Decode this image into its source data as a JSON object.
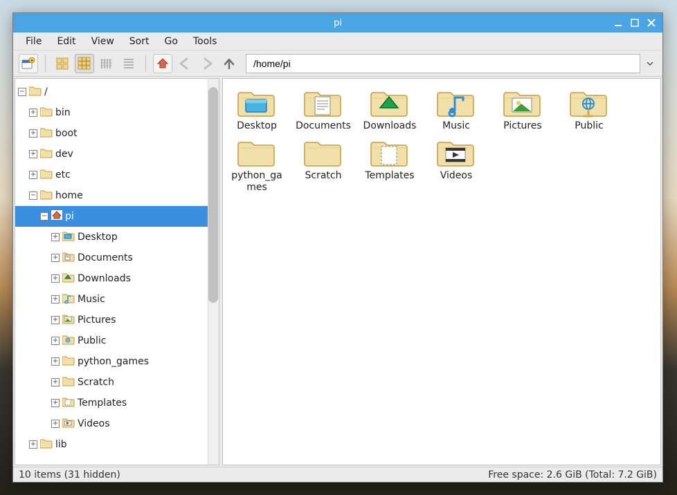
{
  "title": "pi",
  "menu": [
    "File",
    "Edit",
    "View",
    "Sort",
    "Go",
    "Tools"
  ],
  "path": "/home/pi",
  "tree": {
    "root": "/",
    "root_children": [
      {
        "name": "bin",
        "icon": "folder"
      },
      {
        "name": "boot",
        "icon": "folder"
      },
      {
        "name": "dev",
        "icon": "folder"
      },
      {
        "name": "etc",
        "icon": "folder"
      },
      {
        "name": "home",
        "icon": "folder",
        "expanded": true,
        "children": [
          {
            "name": "pi",
            "icon": "home",
            "expanded": true,
            "selected": true,
            "children": [
              {
                "name": "Desktop",
                "icon": "folder-mini-blue"
              },
              {
                "name": "Documents",
                "icon": "folder-mini-doc"
              },
              {
                "name": "Downloads",
                "icon": "folder-mini-dl"
              },
              {
                "name": "Music",
                "icon": "folder-mini-music"
              },
              {
                "name": "Pictures",
                "icon": "folder-mini-pic"
              },
              {
                "name": "Public",
                "icon": "folder-mini-public"
              },
              {
                "name": "python_games",
                "icon": "folder"
              },
              {
                "name": "Scratch",
                "icon": "folder"
              },
              {
                "name": "Templates",
                "icon": "folder-mini-tpl"
              },
              {
                "name": "Videos",
                "icon": "folder-mini-vid"
              }
            ]
          }
        ]
      },
      {
        "name": "lib",
        "icon": "folder"
      }
    ]
  },
  "folders": [
    {
      "name": "Desktop",
      "icon": "folder-desktop"
    },
    {
      "name": "Documents",
      "icon": "folder-documents"
    },
    {
      "name": "Downloads",
      "icon": "folder-downloads"
    },
    {
      "name": "Music",
      "icon": "folder-music"
    },
    {
      "name": "Pictures",
      "icon": "folder-pictures"
    },
    {
      "name": "Public",
      "icon": "folder-public"
    },
    {
      "name": "python_games",
      "icon": "folder"
    },
    {
      "name": "Scratch",
      "icon": "folder"
    },
    {
      "name": "Templates",
      "icon": "folder-templates"
    },
    {
      "name": "Videos",
      "icon": "folder-videos"
    }
  ],
  "status_left": "10 items (31 hidden)",
  "status_right": "Free space: 2.6 GiB (Total: 7.2 GiB)"
}
